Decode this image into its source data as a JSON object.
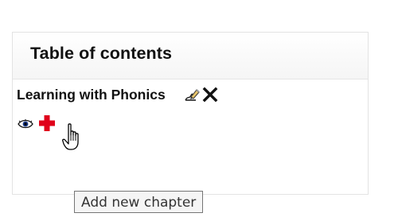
{
  "block": {
    "title": "Table of contents"
  },
  "chapter": {
    "title": "Learning with Phonics"
  },
  "icons": {
    "edit": "edit-icon",
    "delete": "delete-icon",
    "visibility": "eye-icon",
    "add": "plus-icon",
    "cursor": "hand-pointer-icon"
  },
  "tooltip": {
    "text": "Add new chapter"
  },
  "colors": {
    "add_accent": "#e0001b",
    "text": "#111111"
  }
}
